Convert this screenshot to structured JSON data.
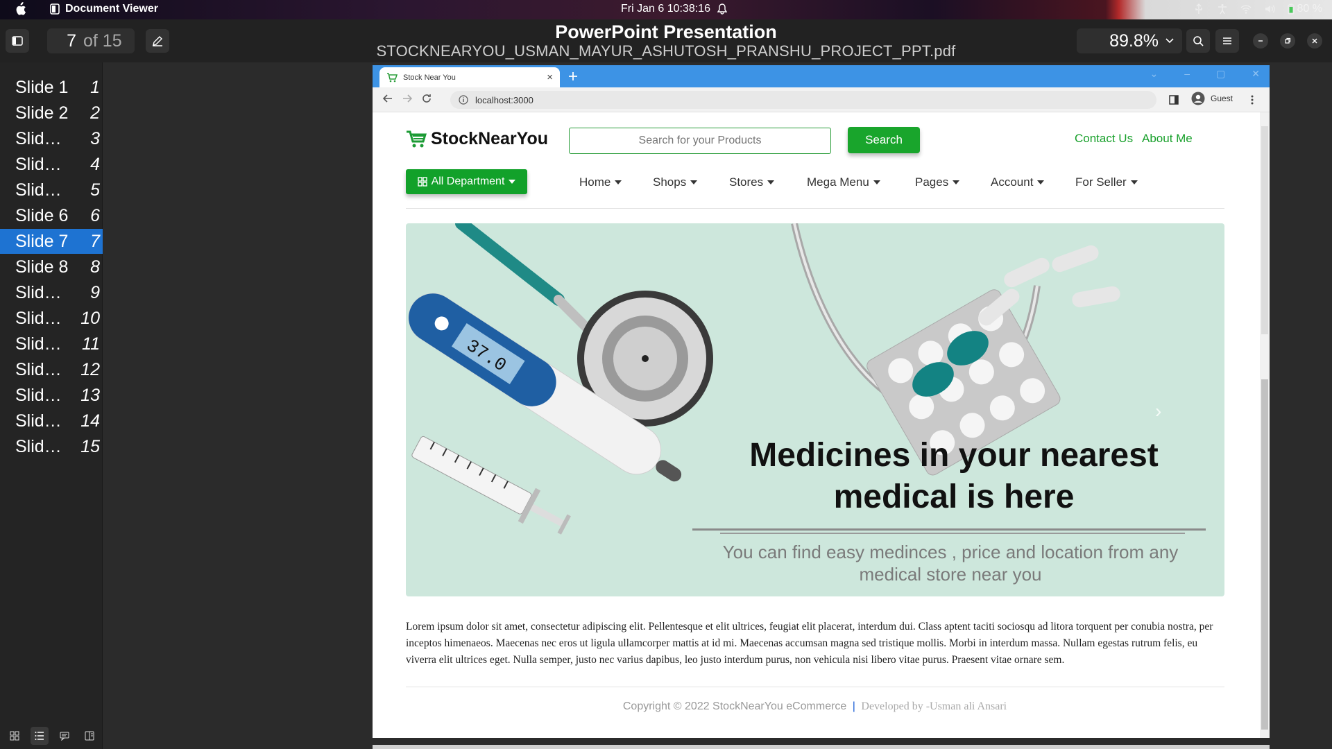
{
  "system_bar": {
    "app_name": "Document Viewer",
    "clock": "Fri Jan 6  10:38:16",
    "battery": "80 %"
  },
  "viewer": {
    "current_page": "7",
    "page_total": "of 15",
    "title": "PowerPoint Presentation",
    "filename": "STOCKNEARYOU_USMAN_MAYUR_ASHUTOSH_PRANSHU_PROJECT_PPT.pdf",
    "zoom": "89.8%"
  },
  "sidebar": {
    "items": [
      {
        "label": "Slide 1",
        "num": "1"
      },
      {
        "label": "Slide 2",
        "num": "2"
      },
      {
        "label": "Slid…",
        "num": "3"
      },
      {
        "label": "Slid…",
        "num": "4"
      },
      {
        "label": "Slid…",
        "num": "5"
      },
      {
        "label": "Slide 6",
        "num": "6"
      },
      {
        "label": "Slide 7",
        "num": "7"
      },
      {
        "label": "Slide 8",
        "num": "8"
      },
      {
        "label": "Slid…",
        "num": "9"
      },
      {
        "label": "Slid…",
        "num": "10"
      },
      {
        "label": "Slid…",
        "num": "11"
      },
      {
        "label": "Slid…",
        "num": "12"
      },
      {
        "label": "Slid…",
        "num": "13"
      },
      {
        "label": "Slid…",
        "num": "14"
      },
      {
        "label": "Slid…",
        "num": "15"
      }
    ],
    "active_index": 6
  },
  "browser": {
    "tab_title": "Stock Near You",
    "url": "localhost:3000",
    "profile": "Guest"
  },
  "site": {
    "brand": "StockNearYou",
    "search_placeholder": "Search for your Products",
    "search_button": "Search",
    "top_links": [
      "Contact Us",
      "About Me"
    ],
    "department_button": "All Department",
    "nav": [
      "Home",
      "Shops",
      "Stores",
      "Mega Menu",
      "Pages",
      "Account",
      "For Seller"
    ],
    "hero": {
      "headline": "Medicines in your nearest medical is here",
      "subtext": "You can find easy medinces , price and location from any medical store near you"
    },
    "body_text": "Lorem ipsum dolor sit amet, consectetur adipiscing elit. Pellentesque et elit ultrices, feugiat elit placerat, interdum dui. Class aptent taciti sociosqu ad litora torquent per conubia nostra, per inceptos himenaeos. Maecenas nec eros ut ligula ullamcorper mattis at id mi. Maecenas accumsan magna sed tristique mollis. Morbi in interdum massa. Nullam egestas rutrum felis, eu viverra elit ultrices eget. Nulla semper, justo nec varius dapibus, leo justo interdum purus, non vehicula nisi libero vitae purus. Praesent vitae ornare sem.",
    "footer_copyright": "Copyright © 2022 StockNearYou eCommerce",
    "footer_separator": "|",
    "footer_dev": "Developed by -Usman ali Ansari"
  },
  "colors": {
    "accent_green": "#19a52c",
    "sidebar_active": "#1e73d2",
    "browser_tab_bar": "#3d93e5",
    "hero_bg": "#cde7dc"
  }
}
